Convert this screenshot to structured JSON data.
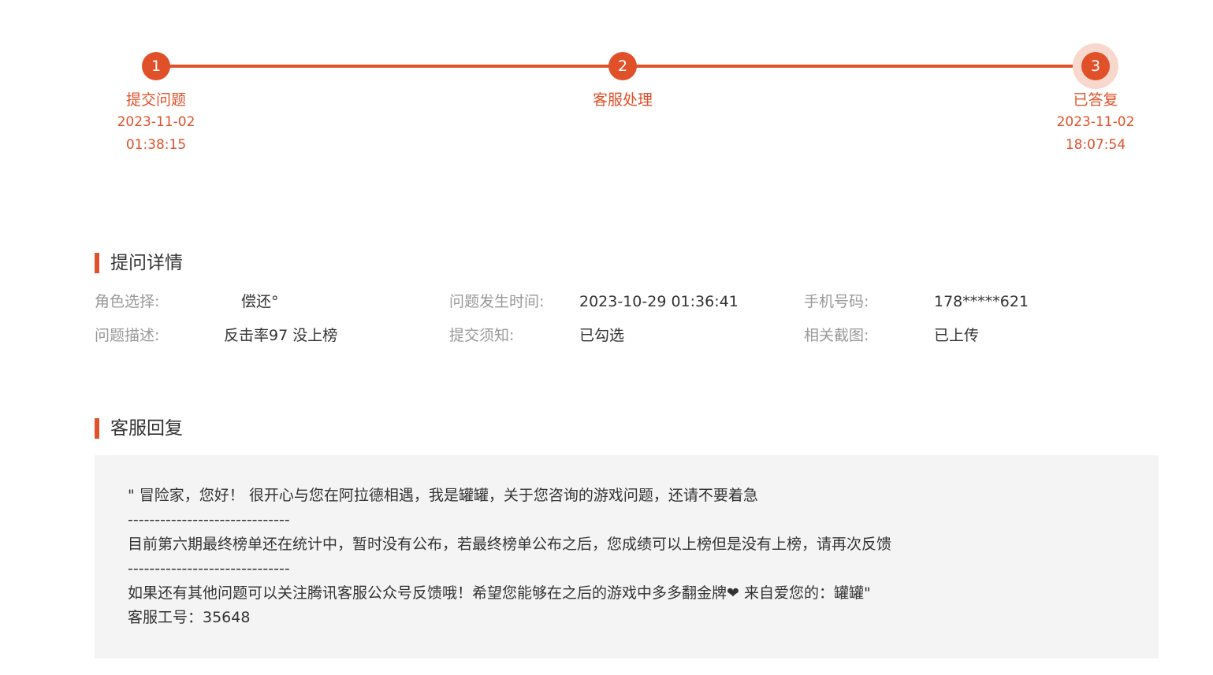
{
  "progress": {
    "steps": [
      {
        "number": "1",
        "label": "提交问题",
        "date": "2023-11-02",
        "time": "01:38:15"
      },
      {
        "number": "2",
        "label": "客服处理"
      },
      {
        "number": "3",
        "label": "已答复",
        "date": "2023-11-02",
        "time": "18:07:54"
      }
    ],
    "accent_color": "#e0512a",
    "current_step": 3
  },
  "question_details": {
    "title": "提问详情",
    "role": {
      "label": "角色选择:",
      "value": "偿还°"
    },
    "occurred_time": {
      "label": "问题发生时间:",
      "value": "2023-10-29 01:36:41"
    },
    "phone": {
      "label": "手机号码:",
      "value": "178*****621"
    },
    "description": {
      "label": "问题描述:",
      "value": "反击率97 没上榜"
    },
    "submit_notice": {
      "label": "提交须知:",
      "value": "已勾选"
    },
    "screenshot": {
      "label": "相关截图:",
      "value": "已上传"
    }
  },
  "reply": {
    "title": "客服回复",
    "lines": [
      "\" 冒险家，您好！  很开心与您在阿拉德相遇，我是罐罐，关于您咨询的游戏问题，还请不要着急",
      "------------------------------",
      "目前第六期最终榜单还在统计中，暂时没有公布，若最终榜单公布之后，您成绩可以上榜但是没有上榜，请再次反馈",
      "------------------------------",
      "如果还有其他问题可以关注腾讯客服公众号反馈哦！希望您能够在之后的游戏中多多翻金牌❤ 来自爱您的：罐罐\"",
      "客服工号：35648"
    ]
  }
}
